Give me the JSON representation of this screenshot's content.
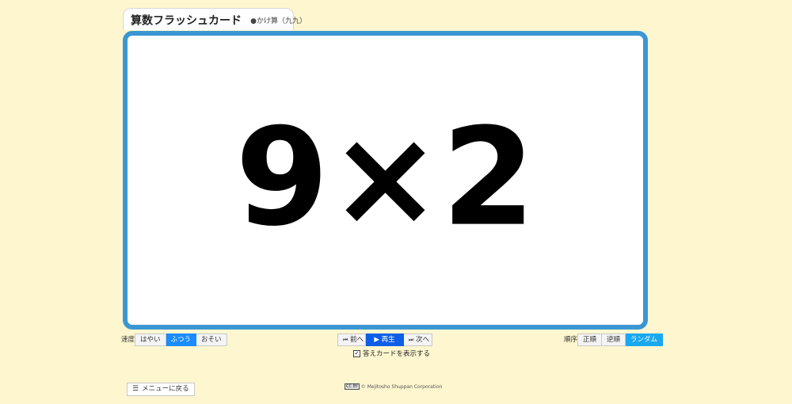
{
  "header": {
    "title": "算数フラッシュカード",
    "subtitle": "●かけ算（九九）"
  },
  "card": {
    "question": "9×2"
  },
  "speed": {
    "label": "速度",
    "options": [
      "はやい",
      "ふつう",
      "おそい"
    ],
    "selected": "ふつう"
  },
  "playback": {
    "prev_label": "前へ",
    "play_label": "▶ 再生",
    "next_label": "次へ"
  },
  "order": {
    "label": "順序",
    "options": [
      "正順",
      "逆順",
      "ランダム"
    ],
    "selected": "ランダム"
  },
  "answer_toggle": {
    "label": "答えカードを表示する",
    "checked": true
  },
  "menu": {
    "back_label": "メニューに戻る"
  },
  "footer": {
    "badge": "CC BY",
    "copyright": "© Mejitosho Shuppan Corporation"
  },
  "colors": {
    "background": "#fdf6cf",
    "card_border": "#3b97d3",
    "active_speed": "#1a8cff",
    "play_button": "#0d5fe8",
    "active_order": "#18a8f0"
  }
}
